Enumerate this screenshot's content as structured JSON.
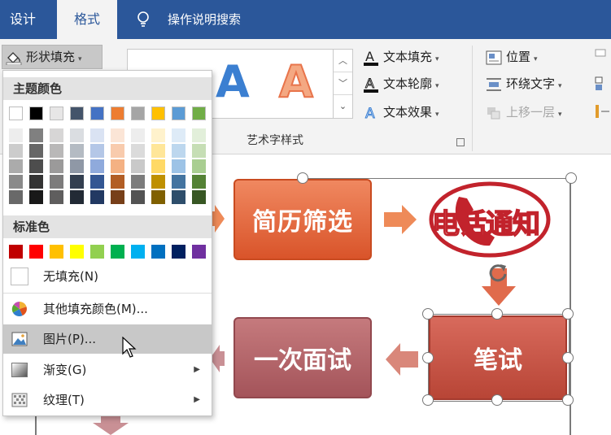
{
  "tabs": {
    "design": "设计",
    "format": "格式",
    "tell_me": "操作说明搜索"
  },
  "ribbon": {
    "shape_fill": "形状填充",
    "wordart_letter": "A",
    "text_fill": "文本填充",
    "text_outline": "文本轮廓",
    "text_effects": "文本效果",
    "wordart_group_label": "艺术字样式",
    "position": "位置",
    "wrap_text": "环绕文字",
    "bring_forward": "上移一层"
  },
  "menu": {
    "theme_colors_label": "主题颜色",
    "standard_colors_label": "标准色",
    "no_fill": "无填充(N)",
    "more_fill_colors": "其他填充颜色(M)...",
    "picture": "图片(P)...",
    "gradient": "渐变(G)",
    "texture": "纹理(T)",
    "theme_colors": [
      "#ffffff",
      "#000000",
      "#e7e6e6",
      "#44546a",
      "#4472c4",
      "#ed7d31",
      "#a5a5a5",
      "#ffc000",
      "#5b9bd5",
      "#70ad47"
    ],
    "standard_colors": [
      "#c00000",
      "#ff0000",
      "#ffc000",
      "#ffff00",
      "#92d050",
      "#00b050",
      "#00b0f0",
      "#0070c0",
      "#002060",
      "#7030a0"
    ]
  },
  "canvas": {
    "box_screening": "简历筛选",
    "phone_notice": "电话通知",
    "written_test": "笔试",
    "first_interview": "一次面试"
  },
  "colors": {
    "accent": "#2b579a",
    "ribbon_bg": "#f3f3f3",
    "hover": "#c8c8c8"
  }
}
